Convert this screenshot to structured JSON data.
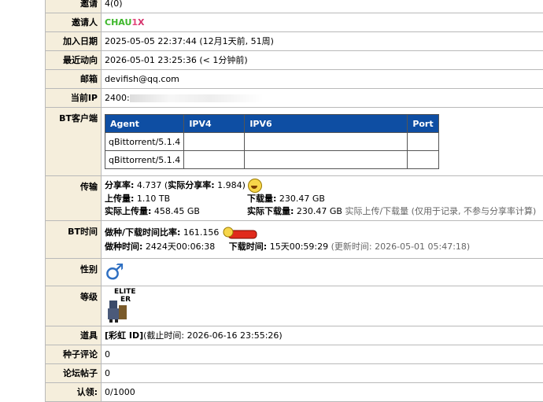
{
  "rows": {
    "invite": {
      "label": "邀请",
      "value": "4(0)"
    },
    "inviter": {
      "label": "邀请人",
      "name_a": "CHAU",
      "name_b": "1",
      "name_c": "X"
    },
    "joined": {
      "label": "加入日期",
      "value": "2025-05-05 22:37:44 (12月1天前, 51周)"
    },
    "last_active": {
      "label": "最近动向",
      "value": "2026-05-01 23:25:36 (< 1分钟前)"
    },
    "email": {
      "label": "邮箱",
      "value": "devifish@qq.com"
    },
    "ip": {
      "label": "当前IP",
      "value": "2400:"
    },
    "bt_client": {
      "label": "BT客户端",
      "columns": [
        "Agent",
        "IPV4",
        "IPV6",
        "Port"
      ],
      "rows": [
        [
          "qBittorrent/5.1.4"
        ],
        [
          "qBittorrent/5.1.4"
        ]
      ]
    },
    "transfer": {
      "label": "传输",
      "ratio_label": "分享率:",
      "ratio": "4.737",
      "real_ratio_label": "实际分享率:",
      "real_ratio": "1.984",
      "upload_label": "上传量:",
      "upload": "1.10 TB",
      "download_label": "下载量:",
      "download": "230.47 GB",
      "real_upload_label": "实际上传量:",
      "real_upload": "458.45 GB",
      "real_download_label": "实际下载量:",
      "real_download": "230.47 GB",
      "note": "实际上传/下载量 (仅用于记录, 不参与分享率计算)"
    },
    "bt_time": {
      "label": "BT时间",
      "seed_ratio_label": "做种/下载时间比率:",
      "seed_ratio": "161.156",
      "seed_time_label": "做种时间:",
      "seed_time": "2424天00:06:38",
      "dl_time_label": "下载时间:",
      "dl_time": "15天00:59:29",
      "updated": "(更新时间: 2026-05-01 05:47:18)"
    },
    "gender": {
      "label": "性别",
      "symbol": "♂"
    },
    "level": {
      "label": "等级",
      "badge_line1": "ELITE",
      "badge_line2": "ER"
    },
    "items": {
      "label": "道具",
      "item": "[彩虹 ID]",
      "expire": "(截止时间: 2026-06-16 23:55:26)"
    },
    "comments": {
      "label": "种子评论",
      "value": "0"
    },
    "posts": {
      "label": "论坛帖子",
      "value": "0"
    },
    "claims": {
      "label": "认领:",
      "value": "0/1000"
    }
  },
  "colors": {
    "label_bg": "#f5eedc",
    "header_blue": "#0e4ea3",
    "male": "#2e6fc2"
  }
}
